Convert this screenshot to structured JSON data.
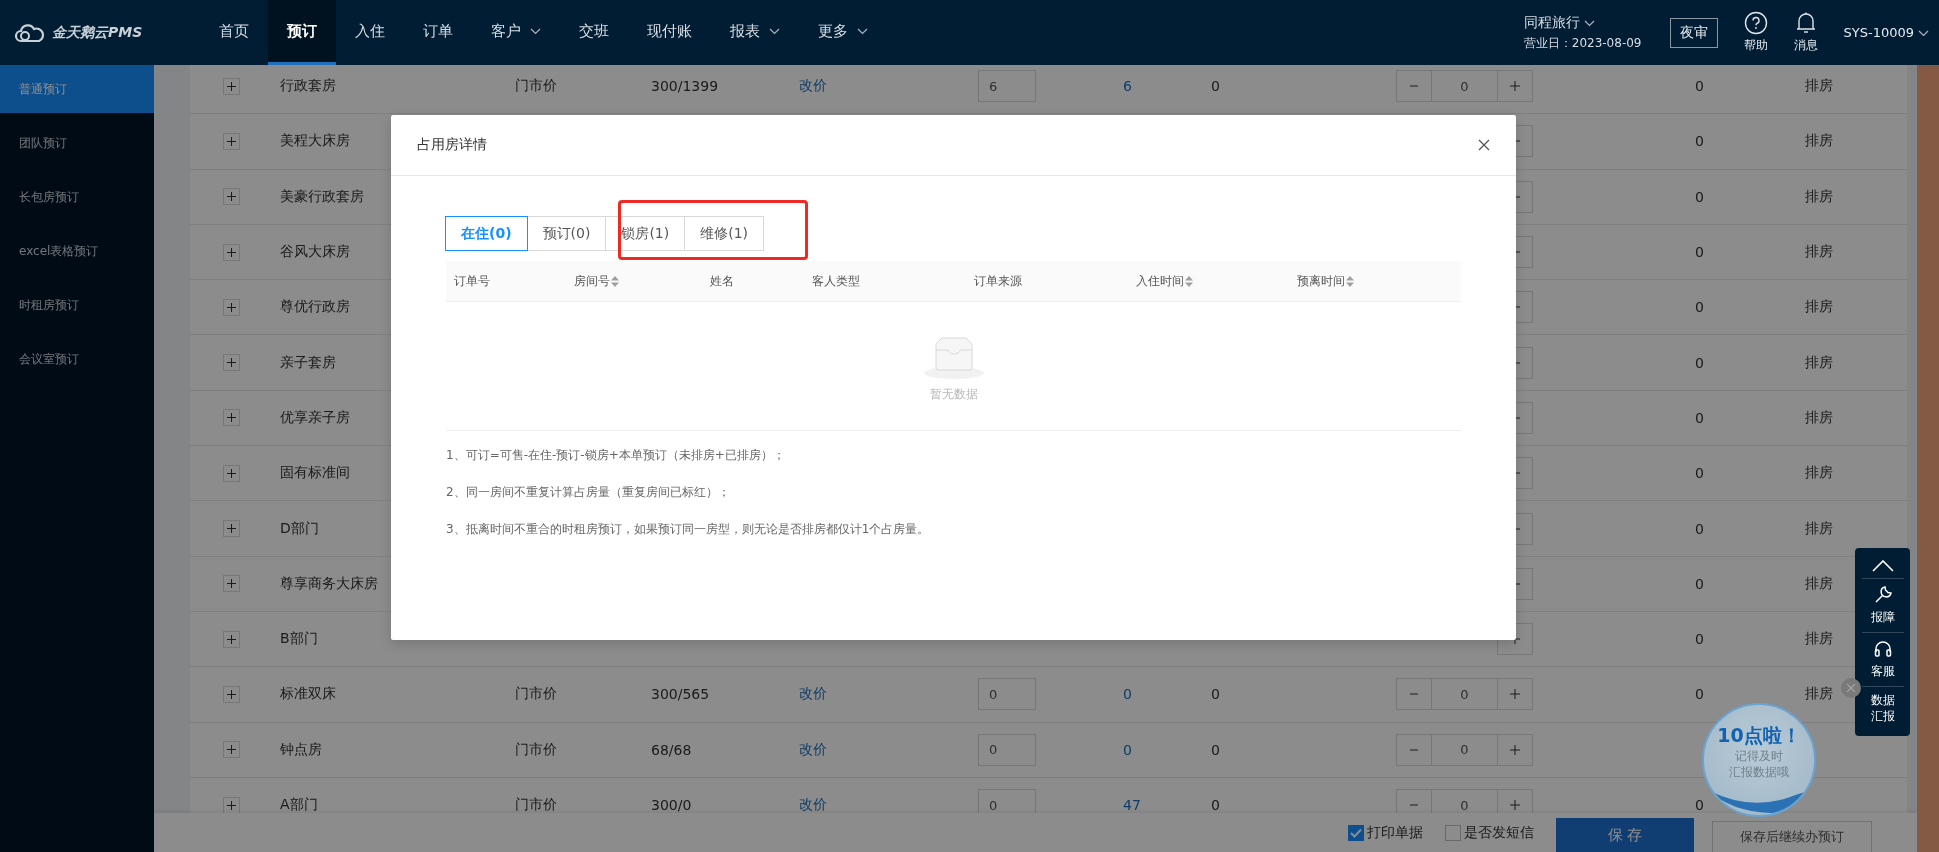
{
  "header": {
    "logo": "金天鹅云PMS",
    "nav": [
      {
        "label": "首页",
        "selected": false,
        "dropdown": false
      },
      {
        "label": "预订",
        "selected": true,
        "dropdown": false
      },
      {
        "label": "入住",
        "selected": false,
        "dropdown": false
      },
      {
        "label": "订单",
        "selected": false,
        "dropdown": false
      },
      {
        "label": "客户",
        "selected": false,
        "dropdown": true
      },
      {
        "label": "交班",
        "selected": false,
        "dropdown": false
      },
      {
        "label": "现付账",
        "selected": false,
        "dropdown": false
      },
      {
        "label": "报表",
        "selected": false,
        "dropdown": true
      },
      {
        "label": "更多",
        "selected": false,
        "dropdown": true
      }
    ],
    "hotel": "同程旅行",
    "business_day": "营业日：2023-08-09",
    "night_audit": "夜审",
    "help": "帮助",
    "messages": "消息",
    "user": "SYS-10009"
  },
  "sidebar": {
    "items": [
      {
        "label": "普通预订",
        "selected": true
      },
      {
        "label": "团队预订",
        "selected": false
      },
      {
        "label": "长包房预订",
        "selected": false
      },
      {
        "label": "excel表格预订",
        "selected": false
      },
      {
        "label": "时租房预订",
        "selected": false
      },
      {
        "label": "会议室预订",
        "selected": false
      }
    ]
  },
  "rows": [
    {
      "name": "行政套房",
      "rate_type": "门市价",
      "price": "300/1399",
      "action": "改价",
      "quantity": "6",
      "available": "6",
      "column_7": "0",
      "stepper_value": "0",
      "column_9": "0",
      "status": "排房"
    },
    {
      "name": "美程大床房",
      "column_9": "0",
      "status": "排房"
    },
    {
      "name": "美豪行政套房",
      "column_9": "0",
      "status": "排房"
    },
    {
      "name": "谷风大床房",
      "column_9": "0",
      "status": "排房"
    },
    {
      "name": "尊优行政房",
      "column_9": "0",
      "status": "排房"
    },
    {
      "name": "亲子套房",
      "column_9": "0",
      "status": "排房"
    },
    {
      "name": "优享亲子房",
      "column_9": "0",
      "status": "排房"
    },
    {
      "name": "固有标准间",
      "column_9": "0",
      "status": "排房"
    },
    {
      "name": "D部门",
      "column_9": "0",
      "status": "排房"
    },
    {
      "name": "尊享商务大床房",
      "column_9": "0",
      "status": "排房"
    },
    {
      "name": "B部门",
      "column_9": "0",
      "status": "排房"
    },
    {
      "name": "标准双床",
      "rate_type": "门市价",
      "price": "300/565",
      "action": "改价",
      "quantity": "0",
      "available": "0",
      "column_7": "0",
      "stepper_value": "0",
      "column_9": "0",
      "status": "排房"
    },
    {
      "name": "钟点房",
      "rate_type": "门市价",
      "price": "68/68",
      "action": "改价",
      "quantity": "0",
      "available": "0",
      "column_7": "0",
      "stepper_value": "0"
    },
    {
      "name": "A部门",
      "rate_type": "门市价",
      "price": "300/0",
      "action": "改价",
      "quantity": "0",
      "available": "47",
      "column_7": "0",
      "stepper_value": "0",
      "column_9": "0"
    }
  ],
  "footer": {
    "print_receipt": {
      "label": "打印单据",
      "checked": true
    },
    "send_sms": {
      "label": "是否发短信",
      "checked": false
    },
    "save": "保 存",
    "save_continue": "保存后继续办预订"
  },
  "float_panel": {
    "items": [
      {
        "kind": "top"
      },
      {
        "kind": "wrench",
        "label": "报障"
      },
      {
        "kind": "headset",
        "label": "客服"
      },
      {
        "kind": "text",
        "label": "数据汇报"
      }
    ]
  },
  "bubble": {
    "title": "10点啦！",
    "lines": [
      "记得及时",
      "汇报数据哦"
    ]
  },
  "modal": {
    "title": "占用房详情",
    "tabs": [
      {
        "label": "在住(0)",
        "selected": true
      },
      {
        "label": "预订(0)",
        "selected": false
      },
      {
        "label": "锁房(1)",
        "selected": false
      },
      {
        "label": "维修(1)",
        "selected": false
      }
    ],
    "columns": [
      {
        "label": "订单号",
        "kind": "plain"
      },
      {
        "label": "房间号",
        "kind": "sortable"
      },
      {
        "label": "姓名",
        "kind": "plain"
      },
      {
        "label": "客人类型",
        "kind": "plain"
      },
      {
        "label": "订单来源",
        "kind": "plain"
      },
      {
        "label": "入住时间",
        "kind": "sortable"
      },
      {
        "label": "预离时间",
        "kind": "sortable"
      }
    ],
    "empty_text": "暂无数据",
    "notes": [
      "1、可订=可售-在住-预订-锁房+本单预订（未排房+已排房）；",
      "2、同一房间不重复计算占房量（重复房间已标红）；",
      "3、抵离时间不重合的时租房预订，如果预订同一房型，则无论是否排房都仅计1个占房量。"
    ]
  }
}
